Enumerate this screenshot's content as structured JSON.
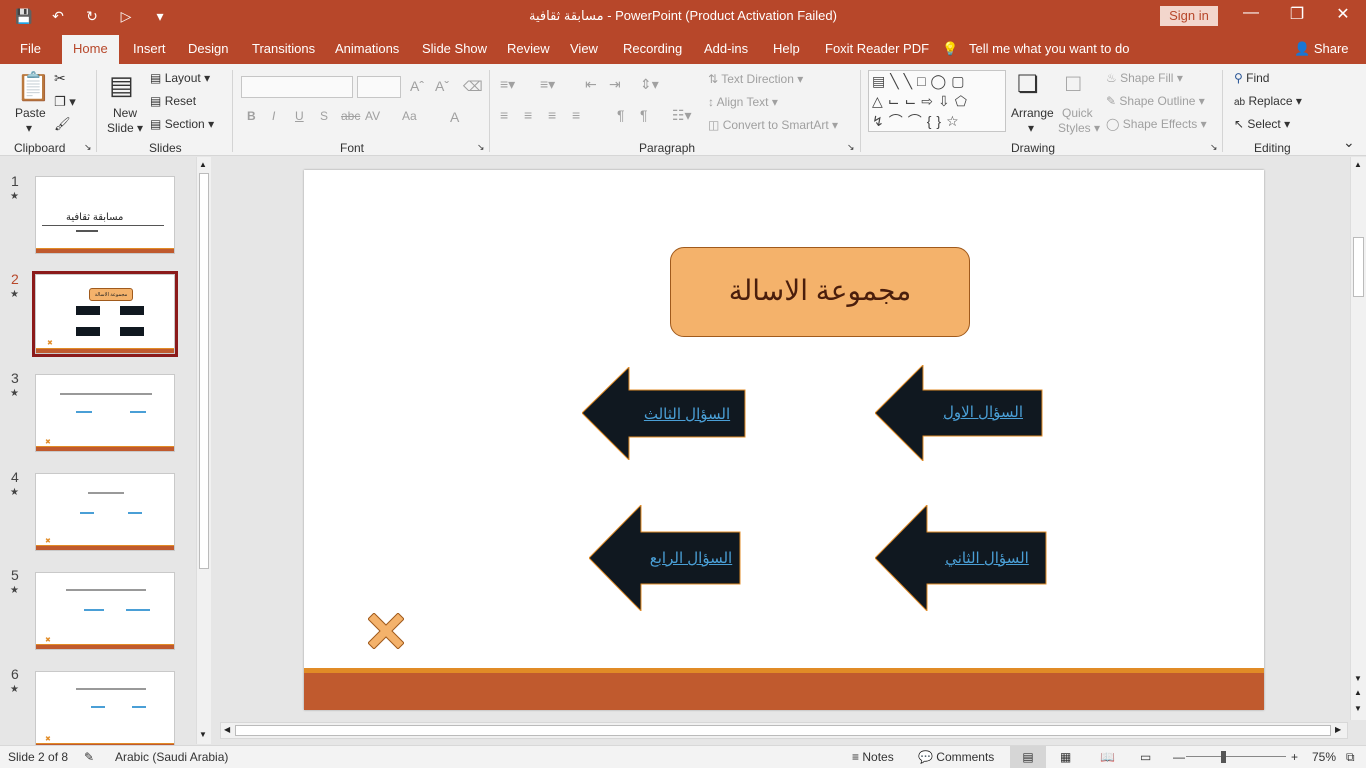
{
  "window": {
    "title": "مسابقة ثقافية  -  PowerPoint (Product Activation Failed)",
    "sign_in": "Sign in",
    "accent": "#b7472a"
  },
  "tabs": [
    "File",
    "Home",
    "Insert",
    "Design",
    "Transitions",
    "Animations",
    "Slide Show",
    "Review",
    "View",
    "Recording",
    "Add-ins",
    "Help",
    "Foxit Reader PDF"
  ],
  "active_tab": "Home",
  "tell_me": "Tell me what you want to do",
  "share": "Share",
  "ribbon": {
    "clipboard": {
      "label": "Clipboard",
      "paste": "Paste"
    },
    "slides": {
      "label": "Slides",
      "new_slide": "New",
      "new_slide2": "Slide",
      "layout": "Layout",
      "reset": "Reset",
      "section": "Section"
    },
    "font": {
      "label": "Font",
      "buttons": [
        "B",
        "I",
        "U",
        "S",
        "abc",
        "AV",
        "Aa",
        "A"
      ]
    },
    "paragraph": {
      "label": "Paragraph",
      "text_direction": "Text Direction",
      "align_text": "Align Text",
      "smartart": "Convert to SmartArt"
    },
    "drawing": {
      "label": "Drawing",
      "arrange": "Arrange",
      "quick": "Quick",
      "styles": "Styles",
      "shape_fill": "Shape Fill",
      "shape_outline": "Shape Outline",
      "shape_effects": "Shape Effects"
    },
    "editing": {
      "label": "Editing",
      "find": "Find",
      "replace": "Replace",
      "select": "Select"
    }
  },
  "thumbnails": [
    {
      "num": "1",
      "title": "مسابقة ثقافية"
    },
    {
      "num": "2",
      "title": "مجموعة الاسالة"
    },
    {
      "num": "3"
    },
    {
      "num": "4"
    },
    {
      "num": "5"
    },
    {
      "num": "6"
    }
  ],
  "slide": {
    "title": "مجموعة الاسالة",
    "arrows": [
      "السؤال الاول",
      "السؤال الثالث",
      "السؤال الثاني",
      "السؤال الرابع"
    ],
    "title_fill": "#f4b26b",
    "arrow_fill": "#101820",
    "link_color": "#4a9fd6",
    "band_color": "#c05a2e"
  },
  "status": {
    "slide": "Slide 2 of 8",
    "language": "Arabic (Saudi Arabia)",
    "notes": "Notes",
    "comments": "Comments",
    "zoom": "75%"
  }
}
